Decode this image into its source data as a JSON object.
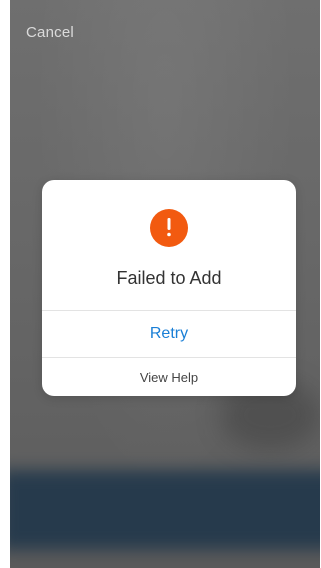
{
  "header": {
    "cancel_label": "Cancel"
  },
  "dialog": {
    "icon": "exclamation-circle-icon",
    "title": "Failed to Add",
    "primary_action_label": "Retry",
    "secondary_action_label": "View Help"
  },
  "colors": {
    "alert_icon": "#f25a10",
    "primary_action": "#1a7fd6",
    "backdrop": "#6c6c6c",
    "bottom_bar": "#24394c"
  }
}
